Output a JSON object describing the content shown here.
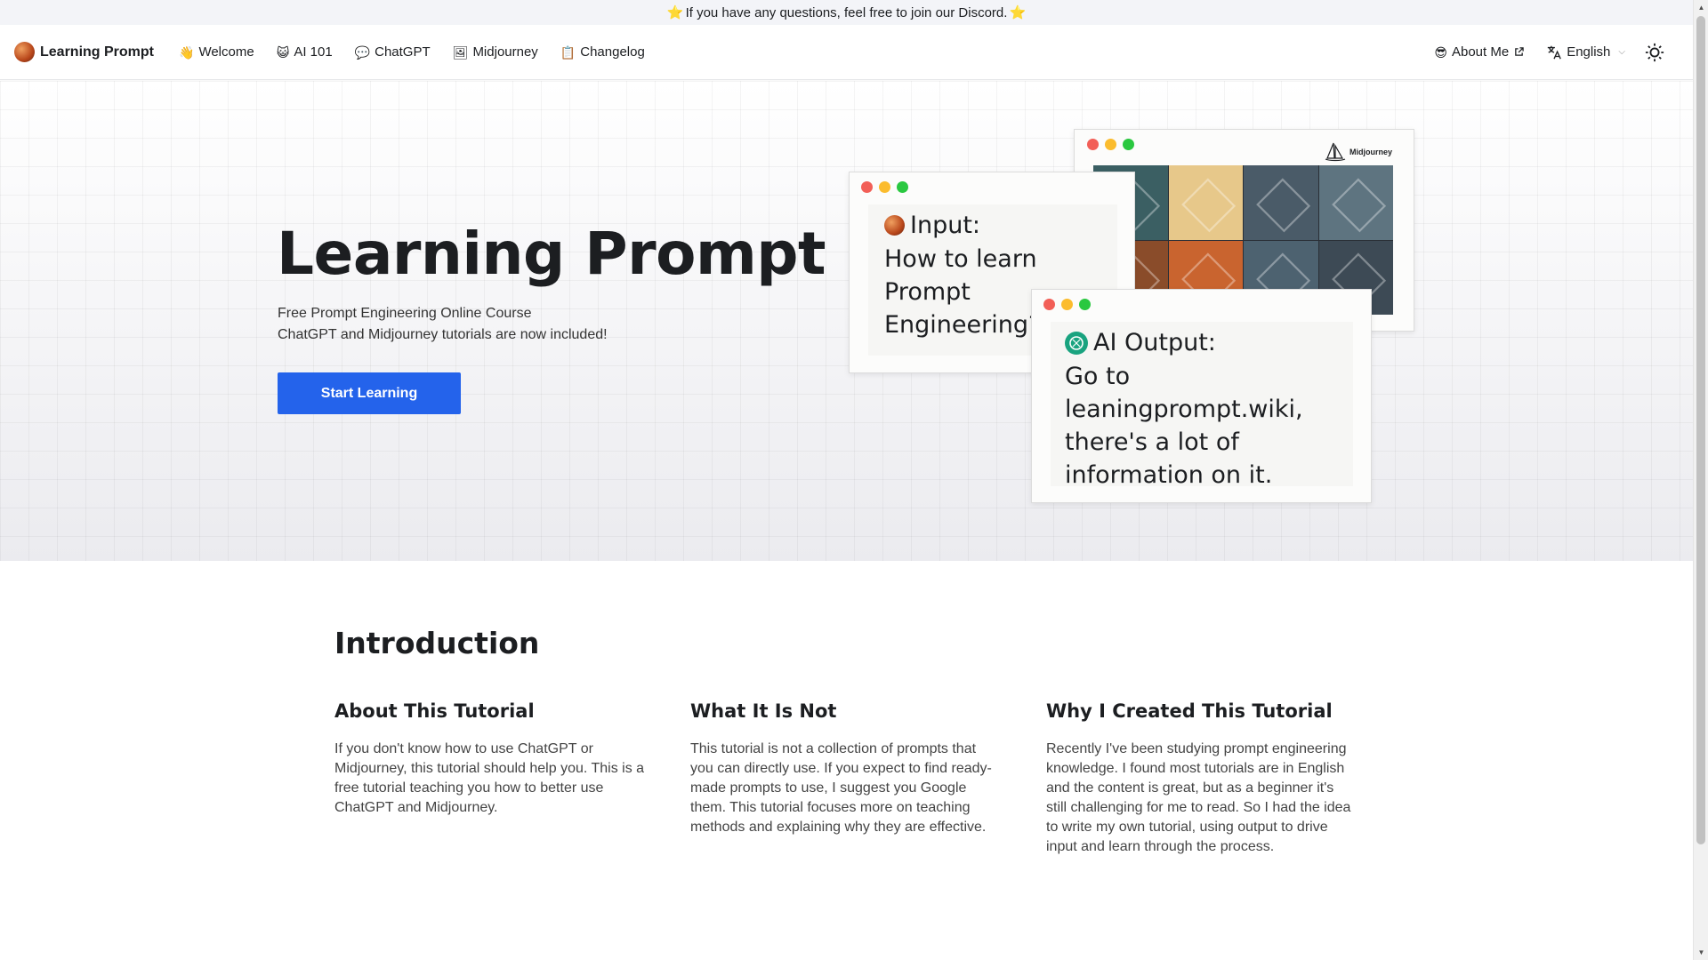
{
  "announcement": {
    "star": "⭐",
    "text": "If you have any questions, feel free to join our Discord."
  },
  "navbar": {
    "brand": "Learning Prompt",
    "items": [
      {
        "icon": "👋",
        "label": "Welcome"
      },
      {
        "icon": "😺",
        "label": "AI 101"
      },
      {
        "icon": "💬",
        "label": "ChatGPT"
      },
      {
        "icon": "🖼",
        "label": "Midjourney"
      },
      {
        "icon": "📋",
        "label": "Changelog"
      }
    ],
    "about": {
      "icon": "😎",
      "label": "About Me"
    },
    "language": {
      "icon": "translate-icon",
      "label": "English"
    },
    "theme_toggle": "sun-icon"
  },
  "hero": {
    "title": "Learning Prompt",
    "subtitle_line1": "Free Prompt Engineering Online Course",
    "subtitle_line2": "ChatGPT and Midjourney tutorials are now included!",
    "cta_label": "Start Learning",
    "input_card": {
      "label": "Input:",
      "text": "How to learn Prompt Engineering?"
    },
    "output_card": {
      "label": "AI Output:",
      "text": "Go to leaningprompt.wiki, there's a lot of information on it."
    },
    "midjourney_card": {
      "brand": "Midjourney"
    }
  },
  "introduction": {
    "heading": "Introduction",
    "columns": [
      {
        "title": "About This Tutorial",
        "text": "If you don't know how to use ChatGPT or Midjourney, this tutorial should help you. This is a free tutorial teaching you how to better use ChatGPT and Midjourney."
      },
      {
        "title": "What It Is Not",
        "text": "This tutorial is not a collection of prompts that you can directly use. If you expect to find ready-made prompts to use, I suggest you Google them. This tutorial focuses more on teaching methods and explaining why they are effective."
      },
      {
        "title": "Why I Created This Tutorial",
        "text": "Recently I've been studying prompt engineering knowledge. I found most tutorials are in English and the content is great, but as a beginner it's still challenging for me to read. So I had the idea to write my own tutorial, using output to drive input and learn through the process."
      }
    ]
  },
  "colors": {
    "primary": "#2463eb",
    "text": "#1c1e21",
    "announcement_bg": "#f3f4f8"
  }
}
